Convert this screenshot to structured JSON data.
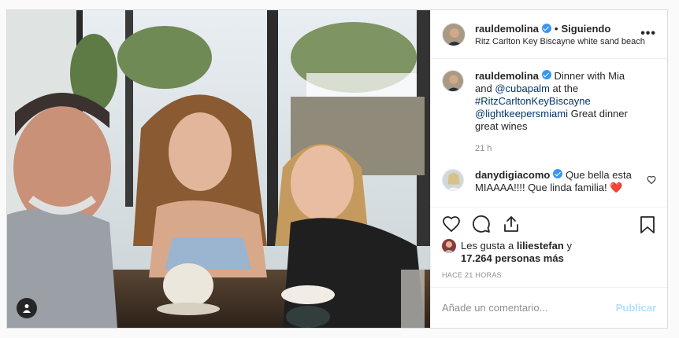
{
  "post": {
    "author": "rauldemolina",
    "follow_label": "Siguiendo",
    "location": "Ritz Carlton Key Biscayne white sand beach",
    "more_label": "•••",
    "caption": {
      "username": "rauldemolina",
      "text_1": " Dinner with Mia and",
      "mention_1": "@cubapalm",
      "text_2": " at the",
      "hashtag": "#RitzCarltonKeyBiscayne",
      "mention_2": "@lightkeepersmiami",
      "text_3": " Great dinner great wines",
      "age": "21 h"
    },
    "comments": [
      {
        "username": "danydigiacomo",
        "text": " Que bella esta MIAAAA!!!! Que linda familia! ❤️"
      }
    ],
    "likes": {
      "prefix": "Les gusta a",
      "first_liker": "liliestefan",
      "joiner": "y",
      "others": "17.264 personas más"
    },
    "timestamp": "HACE 21 HORAS",
    "add_comment": {
      "placeholder": "Añade un comentario...",
      "publish_label": "Publicar"
    }
  },
  "colors": {
    "accent": "#3897f0",
    "publish_disabled": "#b2dffc",
    "heart": "#ed4956"
  },
  "icons": [
    "heart-icon",
    "comment-icon",
    "share-icon",
    "bookmark-icon",
    "user-tag-icon",
    "verified-icon"
  ]
}
